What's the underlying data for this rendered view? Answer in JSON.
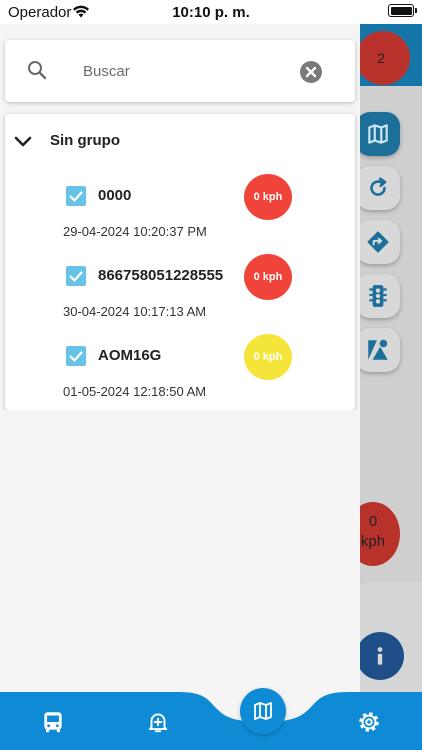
{
  "status_bar": {
    "carrier": "Operador",
    "time": "10:10 p. m.",
    "wifi_icon": "wifi-icon",
    "battery_icon": "battery-icon"
  },
  "background": {
    "notification_count": "2",
    "speed_value": "0",
    "speed_unit": "kph",
    "fab_icons": [
      "map-icon",
      "refresh-icon",
      "directions-icon",
      "traffic-light-icon",
      "layers-icon"
    ],
    "info_icon": "info-icon"
  },
  "search": {
    "placeholder": "Buscar",
    "value": "",
    "icon": "search-icon",
    "clear_icon": "clear-icon"
  },
  "group": {
    "title": "Sin grupo",
    "expanded": true,
    "vehicles": [
      {
        "name": "0000",
        "date": "29-04-2024 10:20:37 PM",
        "speed": "0 kph",
        "checked": true,
        "status_color": "#f0443a"
      },
      {
        "name": "866758051228555",
        "date": "30-04-2024 10:17:13 AM",
        "speed": "0 kph",
        "checked": true,
        "status_color": "#f0443a"
      },
      {
        "name": "AOM16G",
        "date": "01-05-2024 12:18:50 AM",
        "speed": "0 kph",
        "checked": true,
        "status_color": "#f5e43a"
      }
    ]
  },
  "bottom_nav": {
    "items": [
      "bus-icon",
      "alert-bell-icon",
      "map-icon",
      "settings-icon"
    ],
    "accent": "#0f8bd6"
  }
}
